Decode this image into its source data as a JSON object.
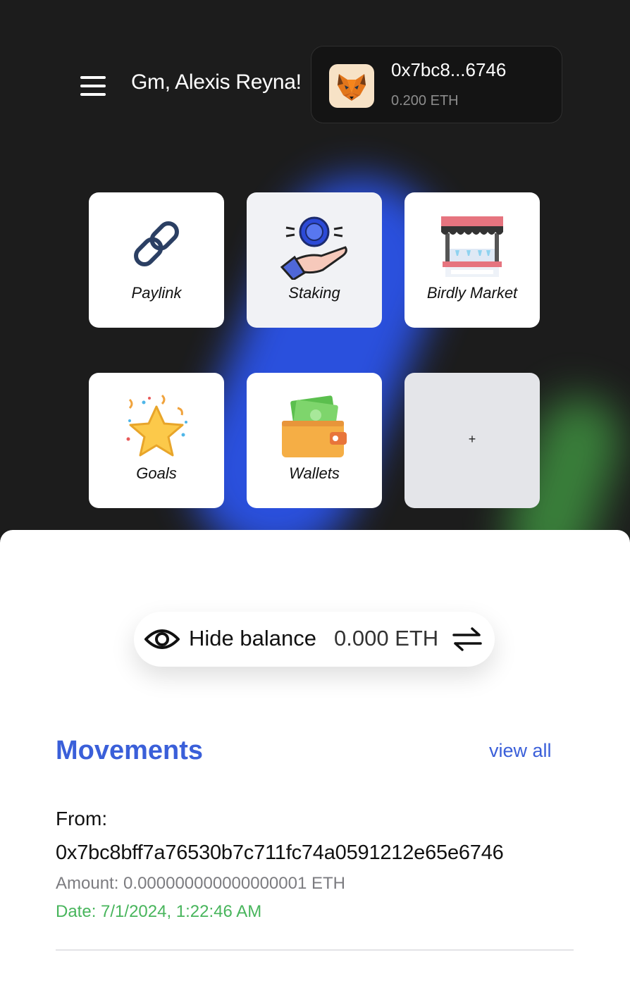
{
  "header": {
    "greeting": "Gm, Alexis Reyna!",
    "wallet": {
      "address": "0x7bc8...6746",
      "balance": "0.200 ETH",
      "icon": "metamask-fox-icon"
    },
    "menu_icon": "hamburger-menu-icon"
  },
  "shortcuts": [
    {
      "label": "Paylink",
      "icon": "chain-link-icon"
    },
    {
      "label": "Staking",
      "icon": "coin-hand-icon"
    },
    {
      "label": "Birdly Market",
      "icon": "market-stall-icon"
    },
    {
      "label": "Goals",
      "icon": "star-confetti-icon"
    },
    {
      "label": "Wallets",
      "icon": "wallet-cash-icon"
    },
    {
      "label": "+",
      "icon": "add-icon"
    }
  ],
  "balance": {
    "toggle_label": "Hide balance",
    "value": "0.000 ETH",
    "eye_icon": "eye-icon",
    "swap_icon": "swap-arrows-icon"
  },
  "movements": {
    "title": "Movements",
    "view_all": "view all",
    "items": [
      {
        "from_label": "From:",
        "from_address": "0x7bc8bff7a76530b7c711fc74a0591212e65e6746",
        "amount": "Amount: 0.000000000000000001 ETH",
        "date": "Date: 7/1/2024, 1:22:46 AM"
      }
    ]
  },
  "colors": {
    "accent_blue": "#3a5fd9",
    "date_green": "#48b55c",
    "background_dark": "#1c1c1c"
  }
}
